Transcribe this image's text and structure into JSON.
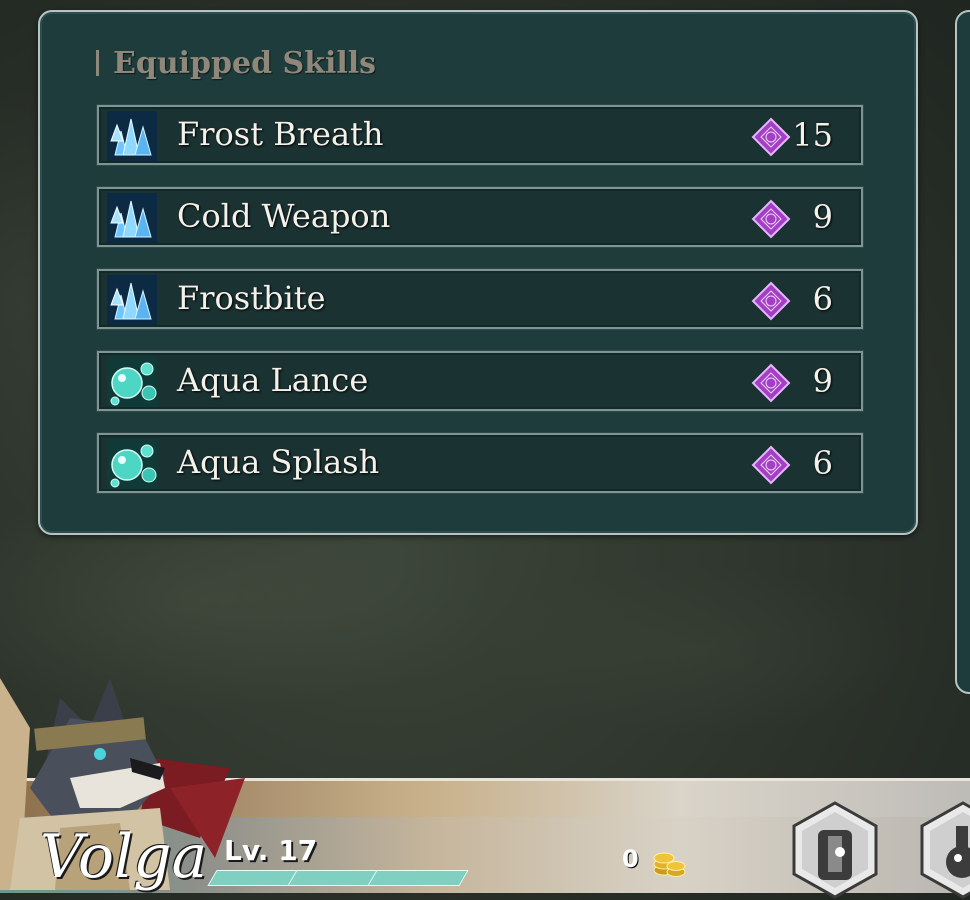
{
  "section": {
    "title": "Equipped Skills"
  },
  "skills": [
    {
      "name": "Frost Breath",
      "cost": "15",
      "icon": "ice-crystal-icon"
    },
    {
      "name": "Cold Weapon",
      "cost": "9",
      "icon": "ice-crystal-icon"
    },
    {
      "name": "Frostbite",
      "cost": "6",
      "icon": "ice-crystal-icon"
    },
    {
      "name": "Aqua Lance",
      "cost": "9",
      "icon": "water-bubbles-icon"
    },
    {
      "name": "Aqua Splash",
      "cost": "6",
      "icon": "water-bubbles-icon"
    }
  ],
  "character": {
    "name": "Volga",
    "level": "Lv. 17"
  },
  "currency": {
    "gold": "0"
  },
  "colors": {
    "panel": "#1f3c3c",
    "gem": "#a23fc4",
    "exp": "#7fd0c0"
  }
}
